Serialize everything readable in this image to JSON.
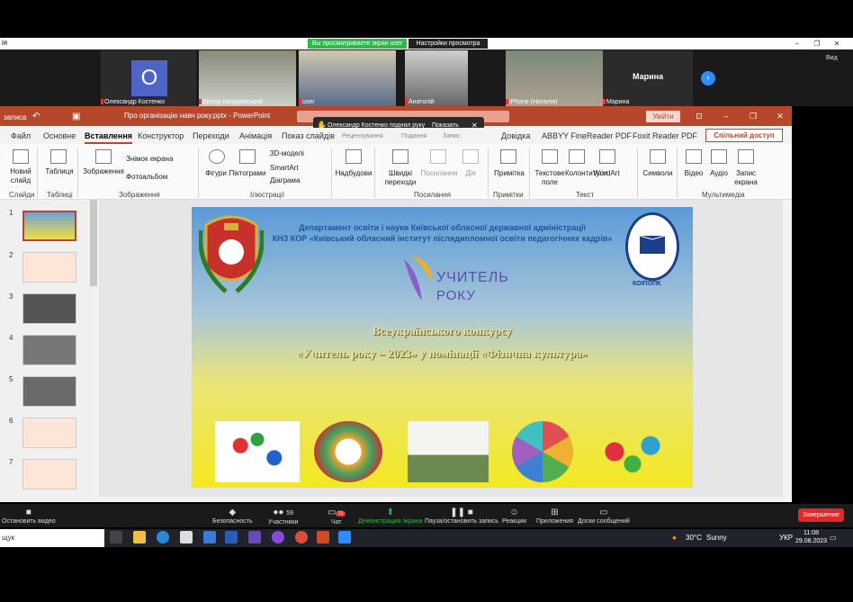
{
  "zoom_top": {
    "title_fragment": "ія",
    "share_banner": "Вы просматриваете экран user",
    "view_settings": "Настройки просмотра",
    "view_mode": "Вид"
  },
  "participants": [
    {
      "name": "Олександр Костенко",
      "initial": "О"
    },
    {
      "name": "Віктор Кануровський"
    },
    {
      "name": "user"
    },
    {
      "name": "Анатолій"
    },
    {
      "name": "iPhone (Наталія)"
    },
    {
      "name": "Марина"
    }
  ],
  "gallery_name_big": "Марина",
  "ppt": {
    "window_title": "Про організацію навч року.pptx - PowerPoint",
    "sign_in": "Увійти",
    "tabs": [
      "Файл",
      "Основне",
      "Вставлення",
      "Конструктор",
      "Переходи",
      "Анімація",
      "Показ слайдів",
      "Рецензування",
      "Подання",
      "Запис",
      "Довідка",
      "ABBYY FineReader PDF",
      "Foxit Reader PDF"
    ],
    "collab": "Спільний доступ",
    "notification": {
      "text": "Олександр Костенко поднял руку",
      "action": "Показать",
      "close": "✕"
    },
    "ribbon": {
      "new_slide": "Новий слайд",
      "table": "Таблиця",
      "images": "Зображення",
      "screenshot": "Знімок екрана",
      "photo_album": "Фотоальбом",
      "shapes": "Фігури",
      "icons": "Піктограми",
      "models3d": "3D-моделі",
      "smartart": "SmartArt",
      "chart": "Діаграма",
      "addins": "Надбудови",
      "quick_transitions": "Швидкі переходи",
      "link": "Посилання",
      "action": "Дія",
      "comment": "Примітка",
      "text_box": "Текстове поле",
      "header_footer": "Колонтитули",
      "wordart": "WordArt",
      "symbols": "Символи",
      "video": "Відео",
      "audio": "Аудіо",
      "screen_rec": "Запис екрана",
      "groups": {
        "slides": "Слайди",
        "tables": "Таблиці",
        "images": "Зображення",
        "illustrations": "Ілюстрації",
        "links": "Посилання",
        "comments": "Примітки",
        "text": "Текст",
        "media": "Мультимедіа"
      }
    },
    "thumb_numbers": [
      "1",
      "2",
      "3",
      "4",
      "5",
      "6",
      "7"
    ],
    "slide": {
      "line1": "Департамент освіти і науки Київської обласної державної адміністрації",
      "line2": "КНЗ КОР «Київський обласний інститут післядипломної освіти педагогічних кадрів»",
      "logo_word1": "УЧИТЕЛЬ",
      "logo_word2": "РОКУ",
      "title1": "Всеукраїнського конкурсу",
      "title2": "«Учитель року – 2023» у номінації «Фізична культура»",
      "seal_text": "КОІПОПК"
    }
  },
  "zoom_controls": {
    "stop_video": "Остановить видео",
    "security": "Безопасность",
    "participants": "Участники",
    "participants_count": "59",
    "chat": "Чат",
    "chat_badge": "11",
    "share_screen": "Демонстрация экрана",
    "pause_record": "Пауза/остановить запись",
    "reactions": "Реакции",
    "apps": "Приложения",
    "whiteboards": "Доски сообщений",
    "end": "Завершение"
  },
  "taskbar": {
    "search": "щук",
    "weather_temp": "30°C",
    "weather_desc": "Sunny",
    "lang": "УКР",
    "time": "11:08",
    "date": "29.08.2023"
  },
  "colors": {
    "ppt_red": "#b7472a",
    "zoom_green": "#2fb84e",
    "end_red": "#e02828"
  }
}
